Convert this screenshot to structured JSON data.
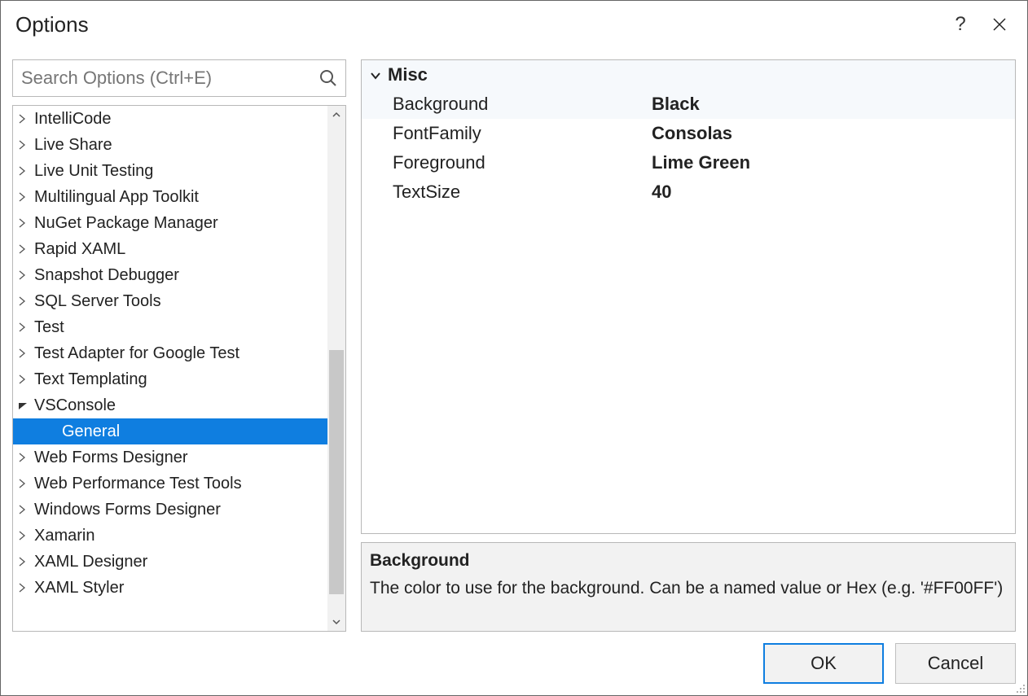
{
  "window": {
    "title": "Options"
  },
  "search": {
    "placeholder": "Search Options (Ctrl+E)"
  },
  "tree": {
    "items": [
      {
        "label": "IntelliCode",
        "expanded": false,
        "child": false,
        "selected": false
      },
      {
        "label": "Live Share",
        "expanded": false,
        "child": false,
        "selected": false
      },
      {
        "label": "Live Unit Testing",
        "expanded": false,
        "child": false,
        "selected": false
      },
      {
        "label": "Multilingual App Toolkit",
        "expanded": false,
        "child": false,
        "selected": false
      },
      {
        "label": "NuGet Package Manager",
        "expanded": false,
        "child": false,
        "selected": false
      },
      {
        "label": "Rapid XAML",
        "expanded": false,
        "child": false,
        "selected": false
      },
      {
        "label": "Snapshot Debugger",
        "expanded": false,
        "child": false,
        "selected": false
      },
      {
        "label": "SQL Server Tools",
        "expanded": false,
        "child": false,
        "selected": false
      },
      {
        "label": "Test",
        "expanded": false,
        "child": false,
        "selected": false
      },
      {
        "label": "Test Adapter for Google Test",
        "expanded": false,
        "child": false,
        "selected": false
      },
      {
        "label": "Text Templating",
        "expanded": false,
        "child": false,
        "selected": false
      },
      {
        "label": "VSConsole",
        "expanded": true,
        "child": false,
        "selected": false
      },
      {
        "label": "General",
        "expanded": false,
        "child": true,
        "selected": true
      },
      {
        "label": "Web Forms Designer",
        "expanded": false,
        "child": false,
        "selected": false
      },
      {
        "label": "Web Performance Test Tools",
        "expanded": false,
        "child": false,
        "selected": false
      },
      {
        "label": "Windows Forms Designer",
        "expanded": false,
        "child": false,
        "selected": false
      },
      {
        "label": "Xamarin",
        "expanded": false,
        "child": false,
        "selected": false
      },
      {
        "label": "XAML Designer",
        "expanded": false,
        "child": false,
        "selected": false
      },
      {
        "label": "XAML Styler",
        "expanded": false,
        "child": false,
        "selected": false
      }
    ]
  },
  "propgrid": {
    "category": "Misc",
    "rows": [
      {
        "name": "Background",
        "value": "Black",
        "selected": true
      },
      {
        "name": "FontFamily",
        "value": "Consolas",
        "selected": false
      },
      {
        "name": "Foreground",
        "value": "Lime Green",
        "selected": false
      },
      {
        "name": "TextSize",
        "value": "40",
        "selected": false
      }
    ]
  },
  "help": {
    "title": "Background",
    "body": "The color to use for the background. Can be a named value or Hex (e.g. '#FF00FF')"
  },
  "buttons": {
    "ok": "OK",
    "cancel": "Cancel"
  }
}
